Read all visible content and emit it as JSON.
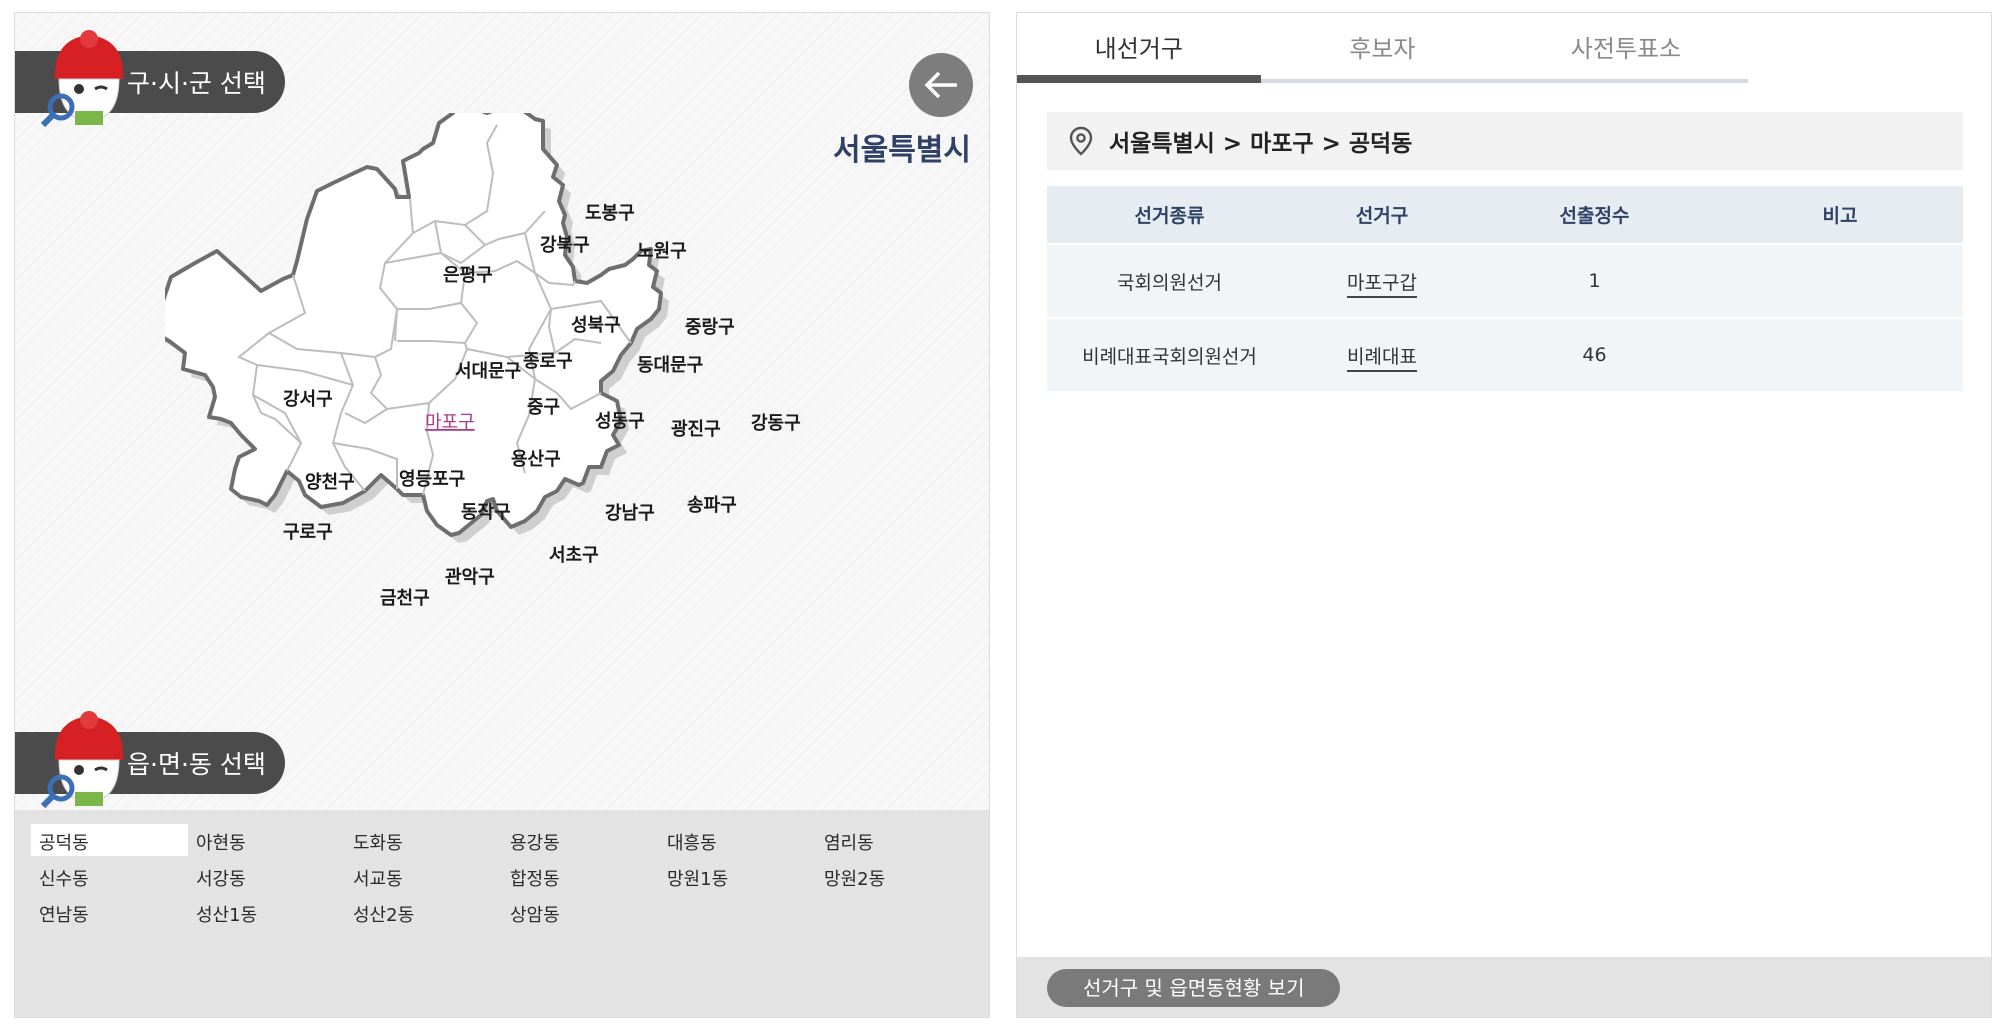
{
  "left_panel": {
    "city_select_label": "구·시·군 선택",
    "dong_select_label": "읍·면·동 선택",
    "region_title": "서울특별시",
    "districts": [
      {
        "name": "도봉구"
      },
      {
        "name": "강북구"
      },
      {
        "name": "노원구"
      },
      {
        "name": "은평구"
      },
      {
        "name": "성북구"
      },
      {
        "name": "중랑구"
      },
      {
        "name": "종로구"
      },
      {
        "name": "동대문구"
      },
      {
        "name": "서대문구"
      },
      {
        "name": "강서구"
      },
      {
        "name": "마포구"
      },
      {
        "name": "중구"
      },
      {
        "name": "성동구"
      },
      {
        "name": "광진구"
      },
      {
        "name": "강동구"
      },
      {
        "name": "용산구"
      },
      {
        "name": "양천구"
      },
      {
        "name": "영등포구"
      },
      {
        "name": "동작구"
      },
      {
        "name": "강남구"
      },
      {
        "name": "송파구"
      },
      {
        "name": "구로구"
      },
      {
        "name": "서초구"
      },
      {
        "name": "관악구"
      },
      {
        "name": "금천구"
      }
    ],
    "selected_district": "마포구",
    "dongs": [
      "공덕동",
      "아현동",
      "도화동",
      "용강동",
      "대흥동",
      "염리동",
      "신수동",
      "서강동",
      "서교동",
      "합정동",
      "망원1동",
      "망원2동",
      "연남동",
      "성산1동",
      "성산2동",
      "상암동"
    ],
    "selected_dong": "공덕동"
  },
  "right_panel": {
    "tabs": [
      {
        "label": "내선거구",
        "active": true
      },
      {
        "label": "후보자",
        "active": false
      },
      {
        "label": "사전투표소",
        "active": false
      }
    ],
    "breadcrumb": "서울특별시 > 마포구 > 공덕동",
    "table": {
      "headers": [
        "선거종류",
        "선거구",
        "선출정수",
        "비고"
      ],
      "rows": [
        {
          "type": "국회의원선거",
          "district": "마포구갑",
          "seats": "1",
          "note": ""
        },
        {
          "type": "비례대표국회의원선거",
          "district": "비례대표",
          "seats": "46",
          "note": ""
        }
      ]
    },
    "status_button_label": "선거구 및 읍면동현황 보기"
  },
  "colors": {
    "accent_navy": "#2f4166",
    "selected_district": "#b03a8a",
    "pill_dark": "#4b4b4b"
  },
  "icons": [
    "mascot-icon",
    "back-arrow-icon",
    "location-pin-icon"
  ]
}
